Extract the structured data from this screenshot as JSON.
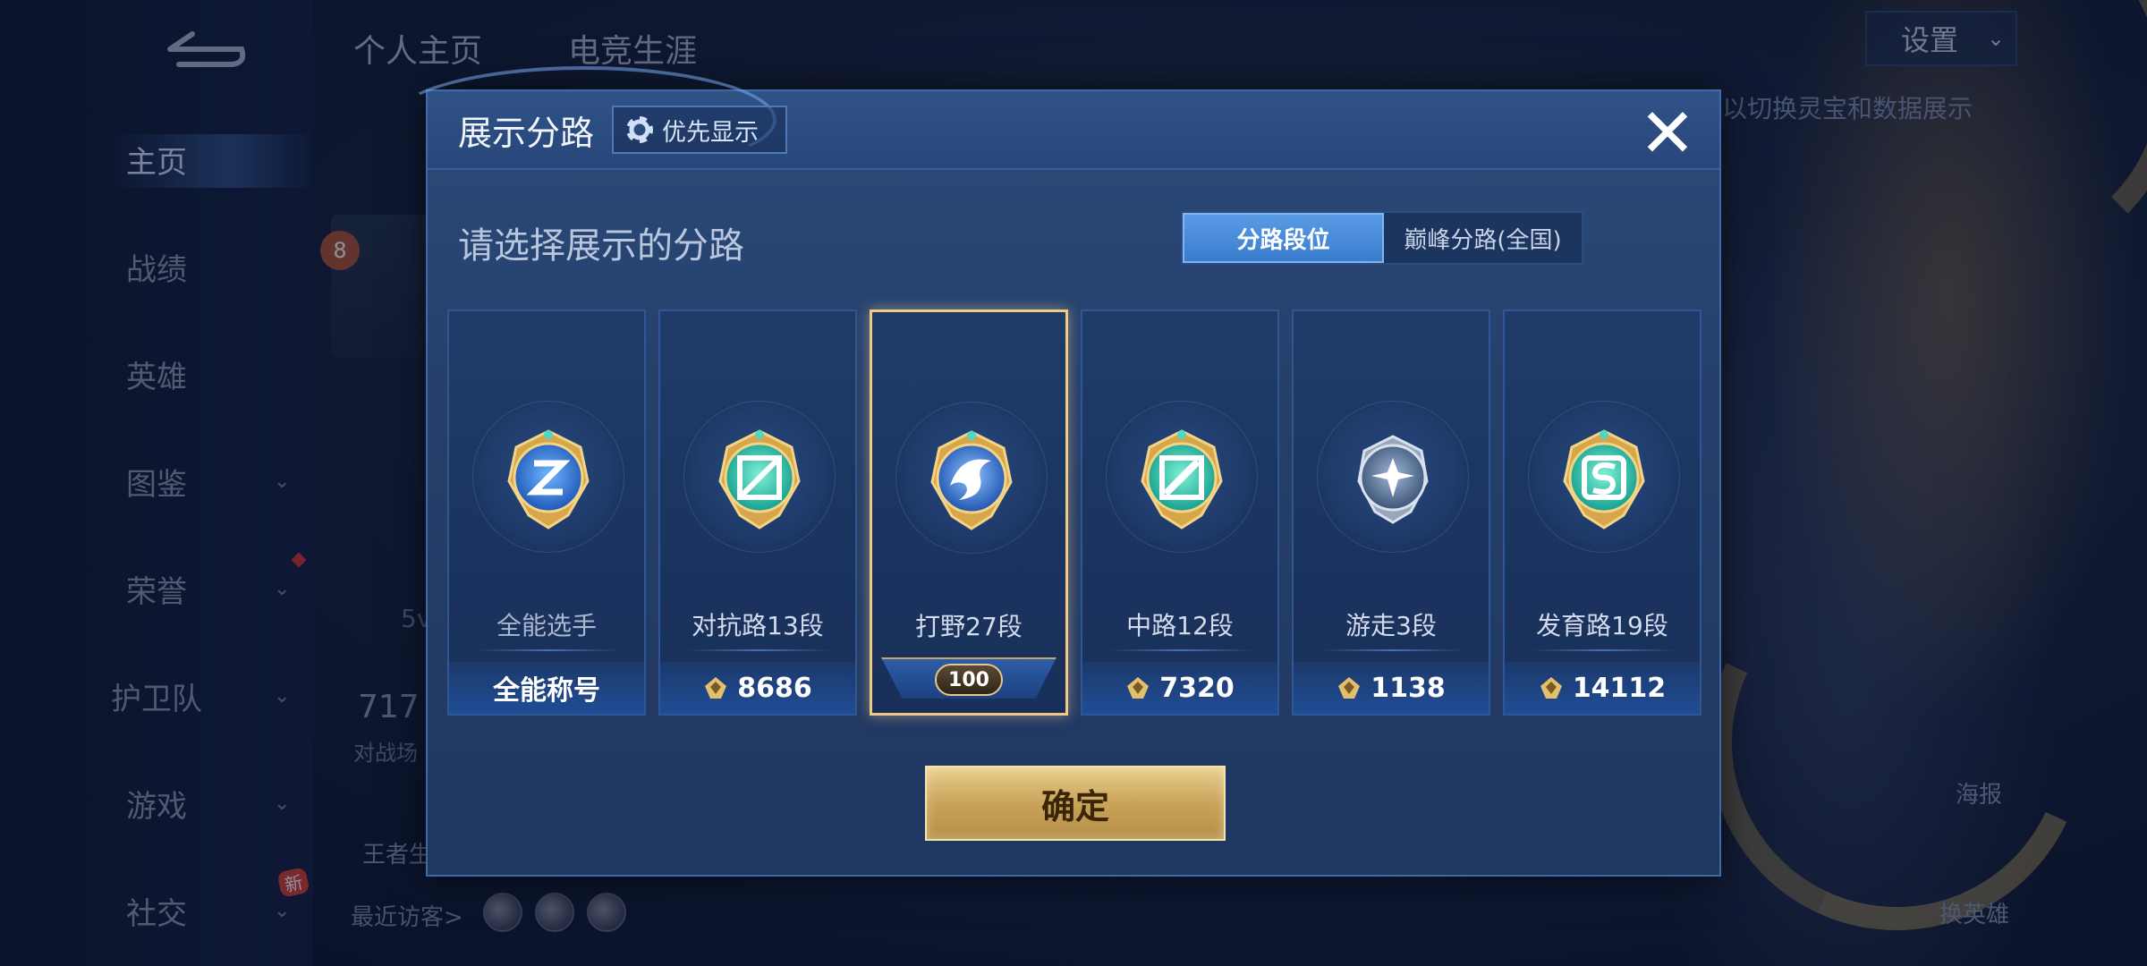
{
  "nav": {
    "items": [
      {
        "label": "主页",
        "active": true
      },
      {
        "label": "战绩"
      },
      {
        "label": "英雄"
      },
      {
        "label": "图鉴"
      },
      {
        "label": "荣誉"
      },
      {
        "label": "护卫队"
      },
      {
        "label": "游戏"
      },
      {
        "label": "社交"
      }
    ],
    "new_badge": "新"
  },
  "background": {
    "tab_personal": "个人主页",
    "tab_esports": "电竞生涯",
    "settings_label": "设置",
    "hint": "以切换灵宝和数据展示",
    "poster_label": "海报",
    "switch_hero_label": "换英雄",
    "visitors_label": "最近访客>",
    "ghost_number": "717",
    "ghost_sub": "对战场",
    "ghost_5v": "5v",
    "rank_badge": "8",
    "king_label": "王者生"
  },
  "modal": {
    "title": "展示分路",
    "priority_label": "优先显示",
    "close_icon": "close-icon",
    "subtitle": "请选择展示的分路",
    "toggle": [
      "分路段位",
      "巅峰分路(全国)"
    ],
    "toggle_active": 0,
    "confirm_label": "确定"
  },
  "cards": [
    {
      "label": "全能选手",
      "value": "全能称号",
      "emblem": "all-round-emblem-icon",
      "coin": false
    },
    {
      "label": "对抗路13段",
      "value": "8686",
      "emblem": "clash-lane-emblem-icon",
      "coin": true
    },
    {
      "label": "打野27段",
      "value": "100",
      "emblem": "jungle-emblem-icon",
      "selected": true,
      "level_plate": true
    },
    {
      "label": "中路12段",
      "value": "7320",
      "emblem": "mid-lane-emblem-icon",
      "coin": true
    },
    {
      "label": "游走3段",
      "value": "1138",
      "emblem": "roam-emblem-icon",
      "coin": true
    },
    {
      "label": "发育路19段",
      "value": "14112",
      "emblem": "farm-lane-emblem-icon",
      "coin": true
    }
  ],
  "colors": {
    "accent_gold": "#f0c985",
    "toggle_active": "#3a7ccd",
    "confirm": "#c9a35a"
  }
}
